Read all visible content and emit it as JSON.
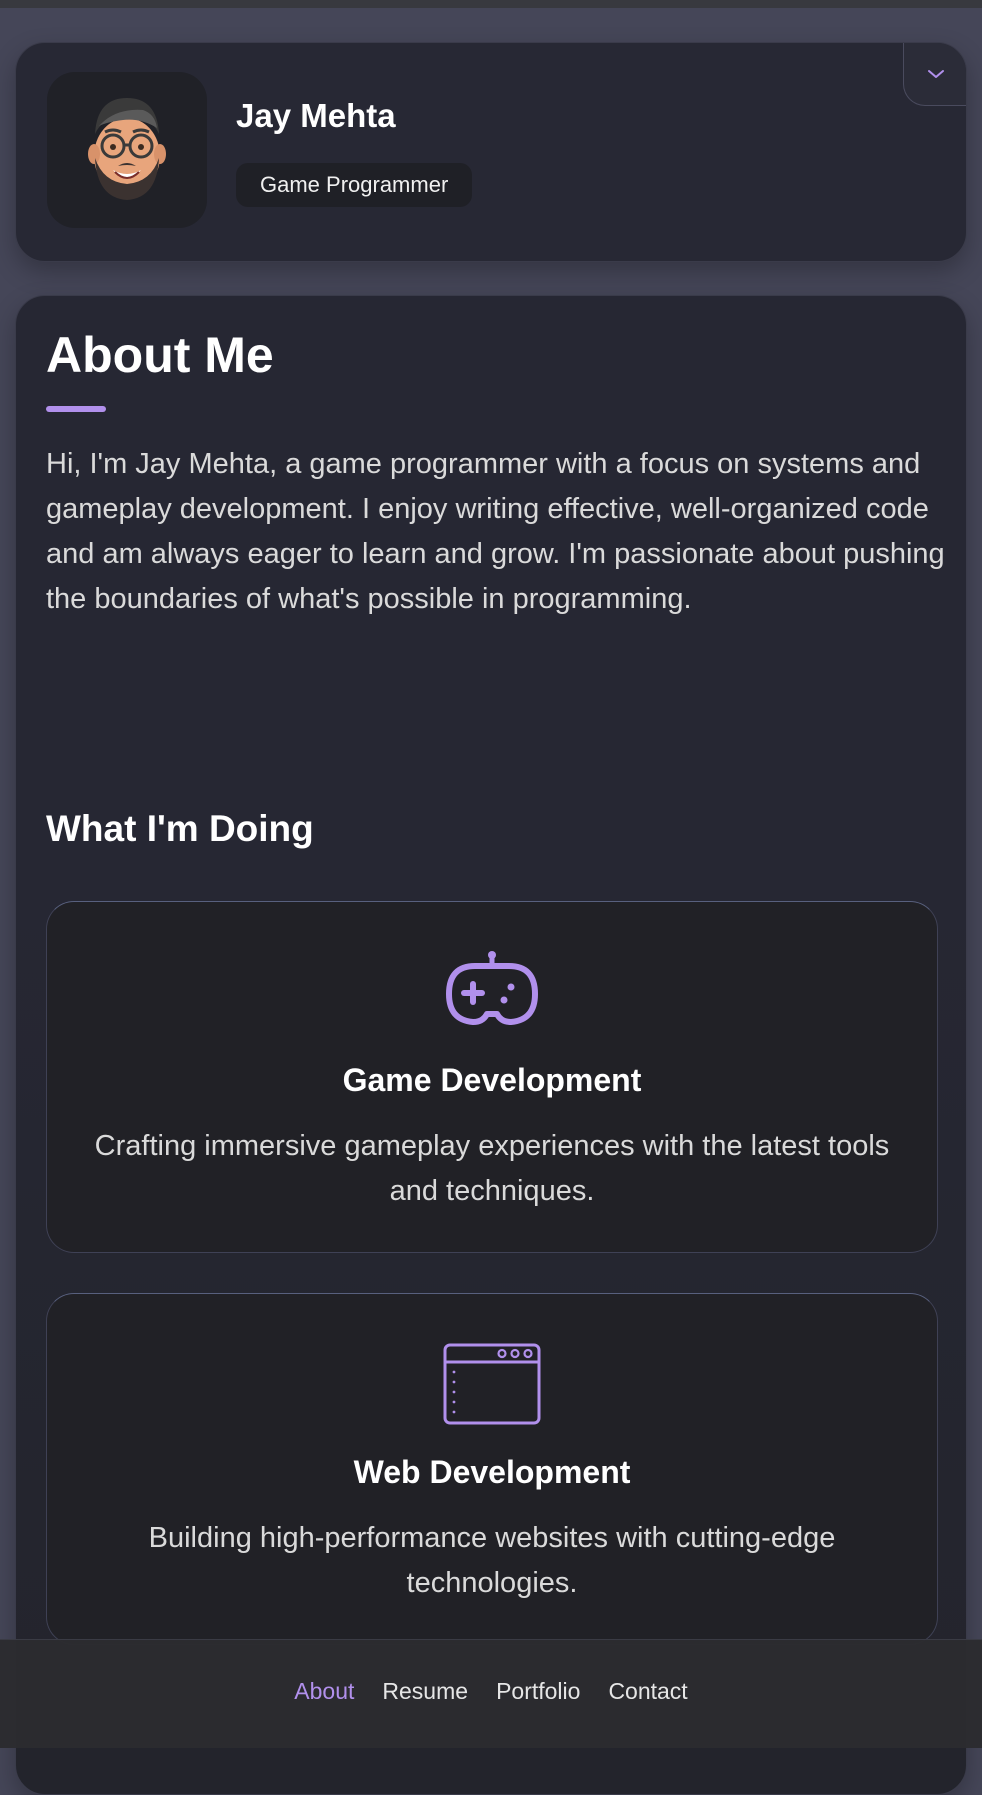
{
  "profile": {
    "name": "Jay Mehta",
    "title": "Game Programmer"
  },
  "about": {
    "heading": "About Me",
    "paragraph": "Hi, I'm Jay Mehta, a game programmer with a focus on systems and gameplay development. I enjoy writing effective, well-organized code and am always eager to learn and grow. I'm passionate about pushing the boundaries of what's possible in programming."
  },
  "services": {
    "heading": "What I'm Doing",
    "items": [
      {
        "icon": "gamepad-icon",
        "title": "Game Development",
        "description": "Crafting immersive gameplay experiences with the latest tools and techniques."
      },
      {
        "icon": "browser-window-icon",
        "title": "Web Development",
        "description": "Building high-performance websites with cutting-edge technologies."
      }
    ]
  },
  "nav": {
    "items": [
      "About",
      "Resume",
      "Portfolio",
      "Contact"
    ],
    "active": "About"
  },
  "colors": {
    "accent": "#b190ec",
    "page_background": "#454658",
    "card_background": "#272834"
  }
}
